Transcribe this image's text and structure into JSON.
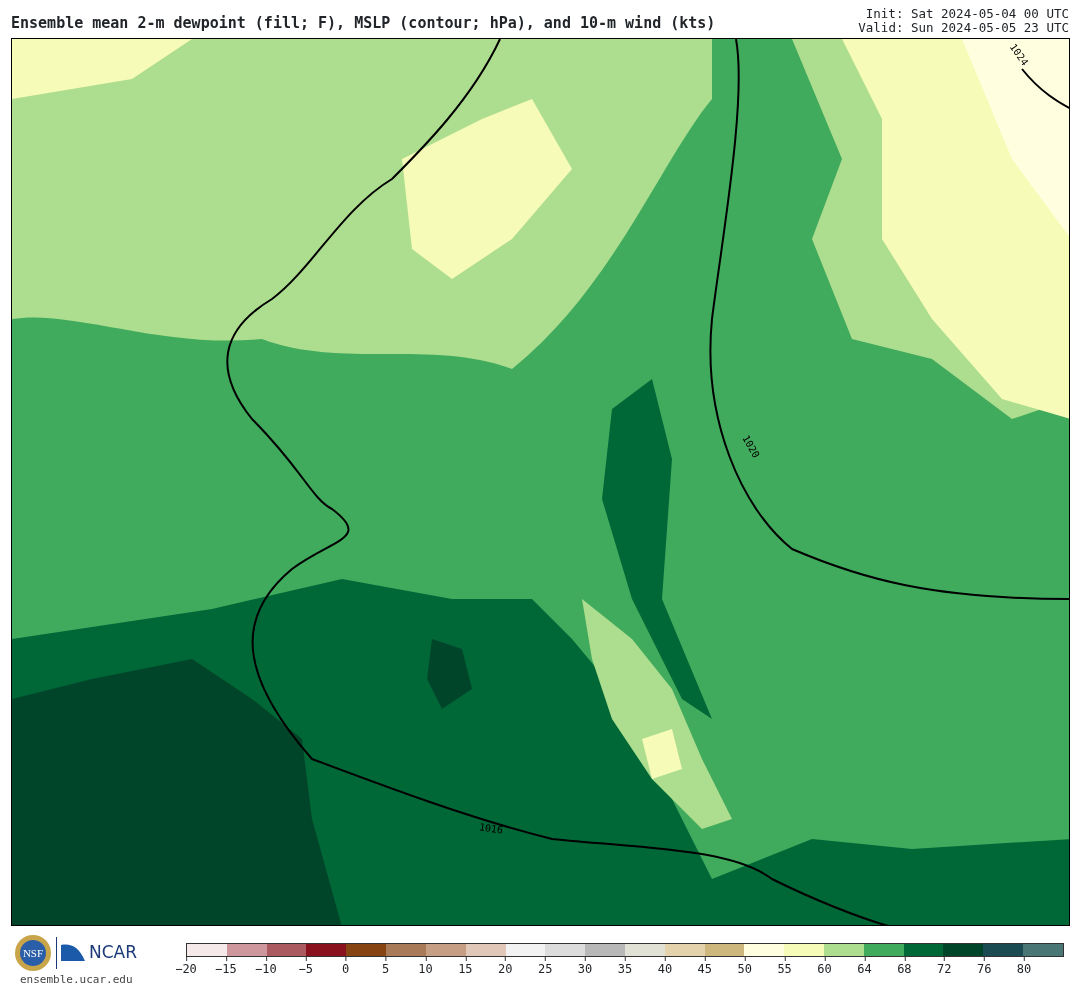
{
  "title": "Ensemble mean 2-m dewpoint (fill; F), MSLP (contour; hPa), and 10-m wind (kts)",
  "init": "Init: Sat 2024-05-04 00 UTC",
  "valid": "Valid: Sun 2024-05-05 23 UTC",
  "map": {
    "contours": [
      {
        "label": "1024"
      },
      {
        "label": "1020"
      },
      {
        "label": "1016"
      }
    ]
  },
  "logos": {
    "nsf": "NSF",
    "ncar": "NCAR",
    "url": "ensemble.ucar.edu"
  },
  "colorbar": {
    "segments": [
      {
        "color": "#f5e9e9"
      },
      {
        "color": "#cd979d"
      },
      {
        "color": "#ab5a60"
      },
      {
        "color": "#8a121e"
      },
      {
        "color": "#864412"
      },
      {
        "color": "#a87a58"
      },
      {
        "color": "#c69e84"
      },
      {
        "color": "#e0c7b7"
      },
      {
        "color": "#f2f2f2"
      },
      {
        "color": "#dcdcdc"
      },
      {
        "color": "#b8b8b8"
      },
      {
        "color": "#e1e2d5"
      },
      {
        "color": "#e4d2ad"
      },
      {
        "color": "#cdb77c"
      },
      {
        "color": "#ffffe0"
      },
      {
        "color": "#f7fbb8"
      },
      {
        "color": "#addd8e"
      },
      {
        "color": "#41ab5d"
      },
      {
        "color": "#006837"
      },
      {
        "color": "#004529"
      },
      {
        "color": "#1a4b53"
      },
      {
        "color": "#4a7676"
      }
    ],
    "ticks": [
      "−20",
      "−15",
      "−10",
      "−5",
      "0",
      "5",
      "10",
      "15",
      "20",
      "25",
      "30",
      "35",
      "40",
      "45",
      "50",
      "55",
      "60",
      "64",
      "68",
      "72",
      "76",
      "80"
    ]
  }
}
